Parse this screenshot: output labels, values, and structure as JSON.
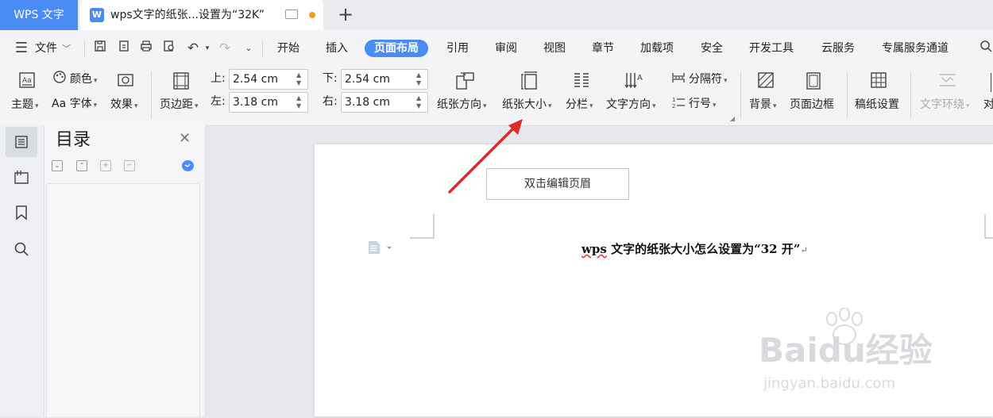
{
  "titlebar": {
    "app_tab": "WPS 文字",
    "doc_tab_title": "wps文字的纸张...设置为“32K”",
    "doc_icon_letter": "W"
  },
  "menu": {
    "file": "文件",
    "tabs": [
      "开始",
      "插入",
      "页面布局",
      "引用",
      "审阅",
      "视图",
      "章节",
      "加载项",
      "安全",
      "开发工具",
      "云服务",
      "专属服务通道"
    ],
    "active_tab": "页面布局"
  },
  "ribbon": {
    "theme": "主题",
    "color": "颜色",
    "font": "字体",
    "font_prefix": "Aa",
    "effect": "效果",
    "margins": "页边距",
    "top_label": "上:",
    "top_value": "2.54 cm",
    "bottom_label": "下:",
    "bottom_value": "2.54 cm",
    "left_label": "左:",
    "left_value": "3.18 cm",
    "right_label": "右:",
    "right_value": "3.18 cm",
    "orientation": "纸张方向",
    "paper_size": "纸张大小",
    "columns": "分栏",
    "text_direction": "文字方向",
    "breaks": "分隔符",
    "line_numbers": "行号",
    "background": "背景",
    "page_border": "页面边框",
    "manuscript": "稿纸设置",
    "text_wrap": "文字环绕",
    "align": "对"
  },
  "nav": {
    "title": "目录"
  },
  "document": {
    "header_placeholder": "双击编辑页眉",
    "heading_wps": "wps",
    "heading_rest": " 文字的纸张大小怎么设置为“32 开”"
  },
  "watermark": {
    "text": "Baidu经验",
    "url": "jingyan.baidu.com"
  },
  "colors": {
    "accent": "#4a8bf5",
    "arrow": "#e02a2a"
  }
}
